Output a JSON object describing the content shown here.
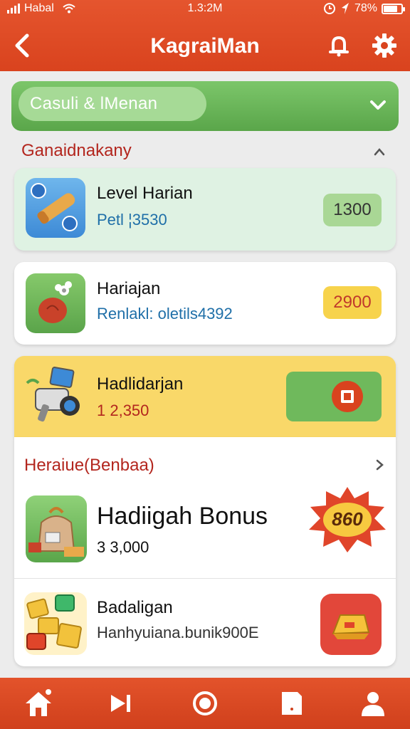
{
  "status_bar": {
    "carrier": "Habal",
    "time": "1.3:2M",
    "battery": "78%",
    "battery_level": 0.78
  },
  "header": {
    "title": "KagraiMan",
    "back_icon": "chevron-left-icon",
    "bell_icon": "bell-icon",
    "settings_icon": "gear-icon"
  },
  "filter": {
    "selected": "Casuli & lMenan",
    "chevron_icon": "chevron-down-icon"
  },
  "section1": {
    "title": "Ganaidnakany",
    "items": [
      {
        "title": "Level Harian",
        "subtitle": "Petl ¦3530",
        "badge": "1300",
        "icon": "scroll-icon"
      },
      {
        "title": "Hariajan",
        "subtitle": "Renlakl: oletils4392",
        "badge": "2900",
        "icon": "apple-flower-icon"
      },
      {
        "title": "Hadlidarjan",
        "subtitle": "1 2,350",
        "badge": "",
        "icon": "camera-gadget-icon",
        "action_icon": "claim-icon"
      }
    ]
  },
  "section2": {
    "title": "Heraiue(Benbaa)",
    "items": [
      {
        "title": "Hadiigah Bonus",
        "subtitle": "3 3,000",
        "badge": "860",
        "icon": "treasure-sack-icon"
      },
      {
        "title": "Badaligan",
        "subtitle": "Hanhyuiana.bunik900E",
        "badge": "",
        "icon": "gold-tiles-icon",
        "action_icon": "gold-bar-icon"
      }
    ]
  },
  "bottom_nav": [
    {
      "name": "home",
      "icon": "home-icon"
    },
    {
      "name": "play",
      "icon": "play-next-icon"
    },
    {
      "name": "center",
      "icon": "circle-icon"
    },
    {
      "name": "tasks",
      "icon": "document-icon"
    },
    {
      "name": "profile",
      "icon": "user-icon"
    }
  ],
  "colors": {
    "brand_red": "#d9431e",
    "green": "#5aa64a",
    "yellow": "#f7d866",
    "section_red": "#b3261e",
    "subtitle_blue": "#1f6fa8"
  }
}
